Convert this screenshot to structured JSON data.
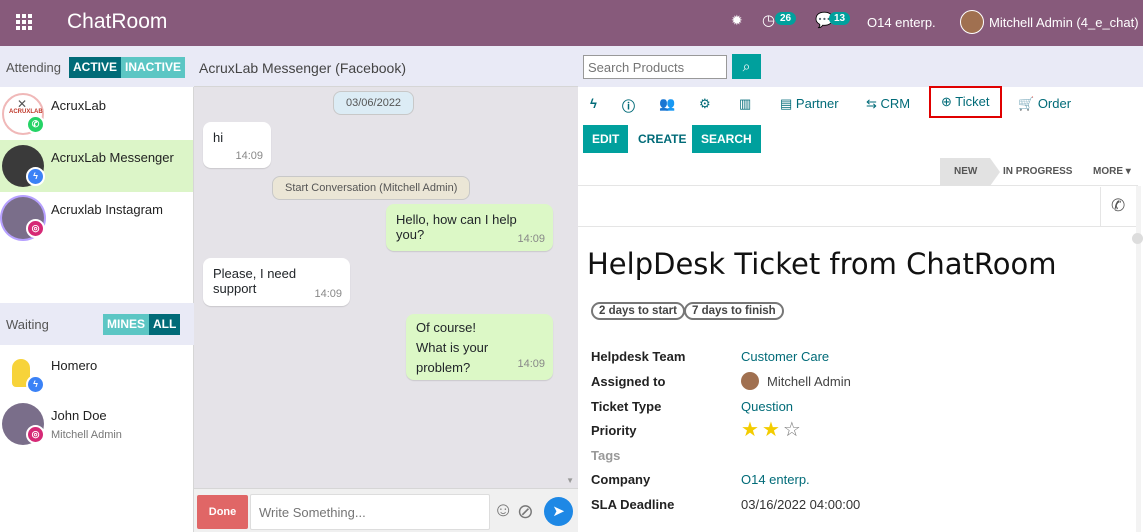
{
  "app": {
    "title": "ChatRoom"
  },
  "topbar": {
    "activity_count": "26",
    "messages_count": "13",
    "company": "O14 enterp.",
    "user": "Mitchell Admin (4_e_chat)"
  },
  "attending": {
    "label": "Attending",
    "toggle": [
      "ACTIVE",
      "INACTIVE"
    ],
    "conversations": [
      {
        "name": "AcruxLab",
        "channel": "whatsapp"
      },
      {
        "name": "AcruxLab Messenger",
        "channel": "messenger"
      },
      {
        "name": "Acruxlab Instagram",
        "channel": "instagram"
      }
    ]
  },
  "waiting": {
    "label": "Waiting",
    "toggle": [
      "MINES",
      "ALL"
    ],
    "conversations": [
      {
        "name": "Homero",
        "sub": "",
        "channel": "messenger"
      },
      {
        "name": "John Doe",
        "sub": "Mitchell Admin",
        "channel": "instagram"
      }
    ]
  },
  "chat": {
    "header": "AcruxLab Messenger (Facebook)",
    "date": "03/06/2022",
    "system": "Start Conversation (Mitchell Admin)",
    "messages": [
      {
        "text": "hi",
        "time": "14:09"
      },
      {
        "text": "Hello, how can I help you?",
        "time": "14:09"
      },
      {
        "text": "Please, I need support",
        "time": "14:09"
      },
      {
        "line1": "Of course!",
        "line2": "What is your problem?",
        "time": "14:09"
      }
    ],
    "done_label": "Done",
    "input_placeholder": "Write Something..."
  },
  "panel": {
    "search_placeholder": "Search Products",
    "tabs": [
      "Partner",
      "CRM",
      "Ticket",
      "Order"
    ],
    "actions": [
      "EDIT",
      "CREATE",
      "SEARCH"
    ],
    "stages": [
      "NEW",
      "IN PROGRESS",
      "MORE"
    ],
    "ticket": {
      "title": "HelpDesk Ticket from ChatRoom",
      "tags": [
        "2 days to start",
        "7 days to finish"
      ],
      "fields": [
        {
          "label": "Helpdesk Team",
          "value": "Customer Care"
        },
        {
          "label": "Assigned to",
          "value": "Mitchell Admin"
        },
        {
          "label": "Ticket Type",
          "value": "Question"
        },
        {
          "label": "Priority",
          "value": ""
        },
        {
          "label": "Tags",
          "value": ""
        },
        {
          "label": "Company",
          "value": "O14 enterp."
        },
        {
          "label": "SLA Deadline",
          "value": "03/16/2022 04:00:00"
        }
      ],
      "priority_stars": 2,
      "priority_max": 3
    }
  },
  "colors": {
    "brand": "#875a7b",
    "teal": "#00a09d",
    "link": "#016b78",
    "highlight": "#e00000"
  }
}
